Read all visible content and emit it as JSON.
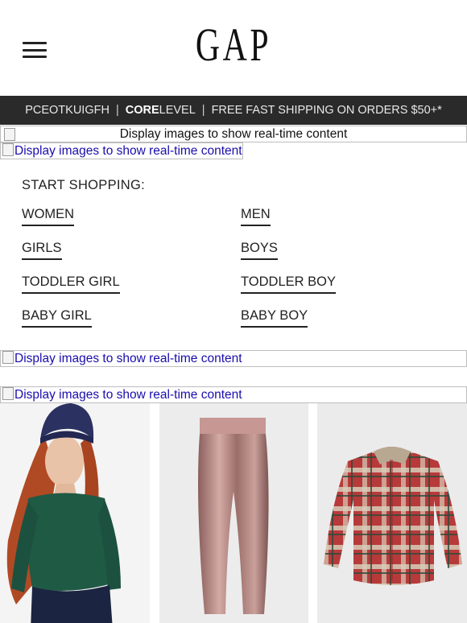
{
  "header": {
    "logo_text": "GAP",
    "menu_icon": "hamburger-menu-icon"
  },
  "promo": {
    "code": "PCEOTKUIGFH",
    "level_bold": "CORE",
    "level_rest": " LEVEL",
    "shipping": "FREE FAST SHIPPING ON ORDERS $50+*",
    "separator": "|"
  },
  "placeholders": {
    "banner_1": "Display images to show real-time content",
    "banner_2": "Display images to show real-time content",
    "banner_3": "Display images to show real-time content",
    "banner_4": "Display images to show real-time content"
  },
  "shop": {
    "title": "START SHOPPING:",
    "links": {
      "women": "WOMEN",
      "men": "MEN",
      "girls": "GIRLS",
      "boys": "BOYS",
      "toddler_girl": "TODDLER GIRL",
      "toddler_boy": "TODDLER BOY",
      "baby_girl": "BABY GIRL",
      "baby_boy": "BABY BOY"
    }
  },
  "products": [
    {
      "image": "woman-green-sweater-beanie",
      "colors": {
        "sweater": "#1f5a45",
        "beanie": "#2b3160",
        "hair": "#b04a24"
      }
    },
    {
      "image": "metallic-pink-leggings",
      "colors": {
        "fabric": "#b78a87"
      }
    },
    {
      "image": "plaid-flannel-shirt",
      "colors": {
        "red": "#b73a3a",
        "cream": "#d8cdb9"
      }
    }
  ]
}
